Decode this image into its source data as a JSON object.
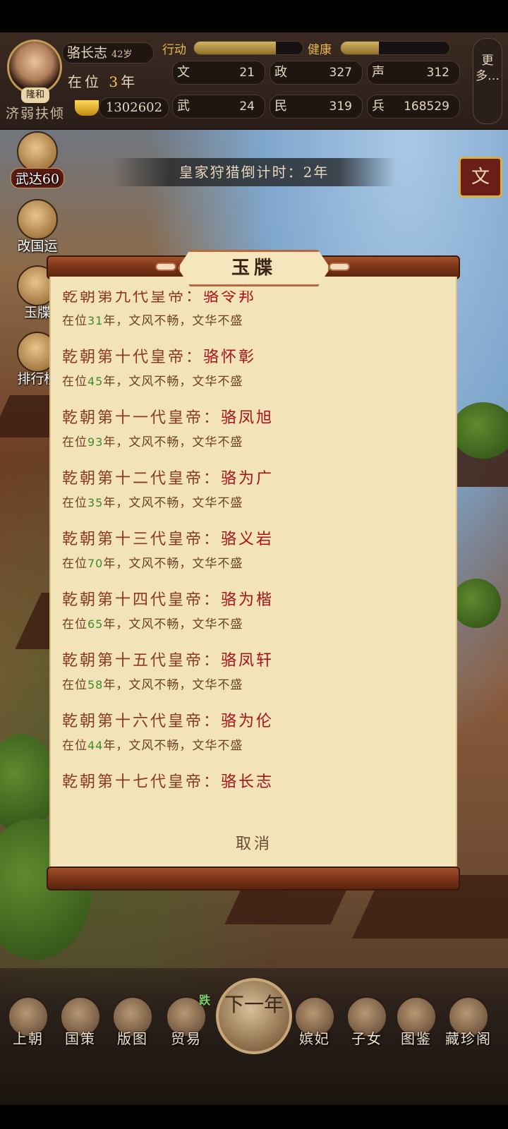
{
  "player": {
    "name": "骆长志",
    "age": "42岁",
    "reign_prefix": "在位",
    "reign_years": "3",
    "reign_suffix": "年",
    "era": "隆和",
    "motto": "济弱扶倾",
    "gold": "1302602"
  },
  "bars": {
    "action_label": "行动",
    "action_level": 0.75,
    "health_label": "健康",
    "health_level": 0.35
  },
  "stats": [
    {
      "label": "文",
      "value": "21"
    },
    {
      "label": "政",
      "value": "327"
    },
    {
      "label": "声",
      "value": "312"
    },
    {
      "label": "武",
      "value": "24"
    },
    {
      "label": "民",
      "value": "319"
    },
    {
      "label": "兵",
      "value": "168529"
    }
  ],
  "more_label": "更多…",
  "side_buttons": [
    {
      "label": "武达60"
    },
    {
      "label": "改国运"
    },
    {
      "label": "玉牒"
    },
    {
      "label": "排行榜"
    }
  ],
  "countdown": "皇家狩猎倒计时：2年",
  "wen_button": "文",
  "modal": {
    "title": "玉牒",
    "cancel": "取消",
    "entries": [
      {
        "title": "乾朝第九代皇帝：",
        "emperor": "骆令邦",
        "prefix": "在位",
        "years": "31",
        "suffix": "年，文风不畅，文华不盛"
      },
      {
        "title": "乾朝第十代皇帝：",
        "emperor": "骆怀彰",
        "prefix": "在位",
        "years": "45",
        "suffix": "年，文风不畅，文华不盛"
      },
      {
        "title": "乾朝第十一代皇帝：",
        "emperor": "骆凤旭",
        "prefix": "在位",
        "years": "93",
        "suffix": "年，文风不畅，文华不盛"
      },
      {
        "title": "乾朝第十二代皇帝：",
        "emperor": "骆为广",
        "prefix": "在位",
        "years": "35",
        "suffix": "年，文风不畅，文华不盛"
      },
      {
        "title": "乾朝第十三代皇帝：",
        "emperor": "骆义岩",
        "prefix": "在位",
        "years": "70",
        "suffix": "年，文风不畅，文华不盛"
      },
      {
        "title": "乾朝第十四代皇帝：",
        "emperor": "骆为楷",
        "prefix": "在位",
        "years": "65",
        "suffix": "年，文风不畅，文华不盛"
      },
      {
        "title": "乾朝第十五代皇帝：",
        "emperor": "骆凤轩",
        "prefix": "在位",
        "years": "58",
        "suffix": "年，文风不畅，文华不盛"
      },
      {
        "title": "乾朝第十六代皇帝：",
        "emperor": "骆为伦",
        "prefix": "在位",
        "years": "44",
        "suffix": "年，文风不畅，文华不盛"
      },
      {
        "title": "乾朝第十七代皇帝：",
        "emperor": "骆长志",
        "prefix": "",
        "years": "",
        "suffix": ""
      }
    ]
  },
  "bottom_nav": [
    {
      "label": "上朝",
      "icon": "court-icon"
    },
    {
      "label": "国策",
      "icon": "policy-icon"
    },
    {
      "label": "版图",
      "icon": "map-icon"
    },
    {
      "label": "贸易",
      "icon": "trade-icon",
      "badge": "跌"
    },
    {
      "label": "下一年",
      "icon": "next-year-icon"
    },
    {
      "label": "嫔妃",
      "icon": "consort-icon"
    },
    {
      "label": "子女",
      "icon": "children-icon"
    },
    {
      "label": "图鉴",
      "icon": "gallery-icon"
    },
    {
      "label": "藏珍阁",
      "icon": "treasure-icon"
    }
  ]
}
